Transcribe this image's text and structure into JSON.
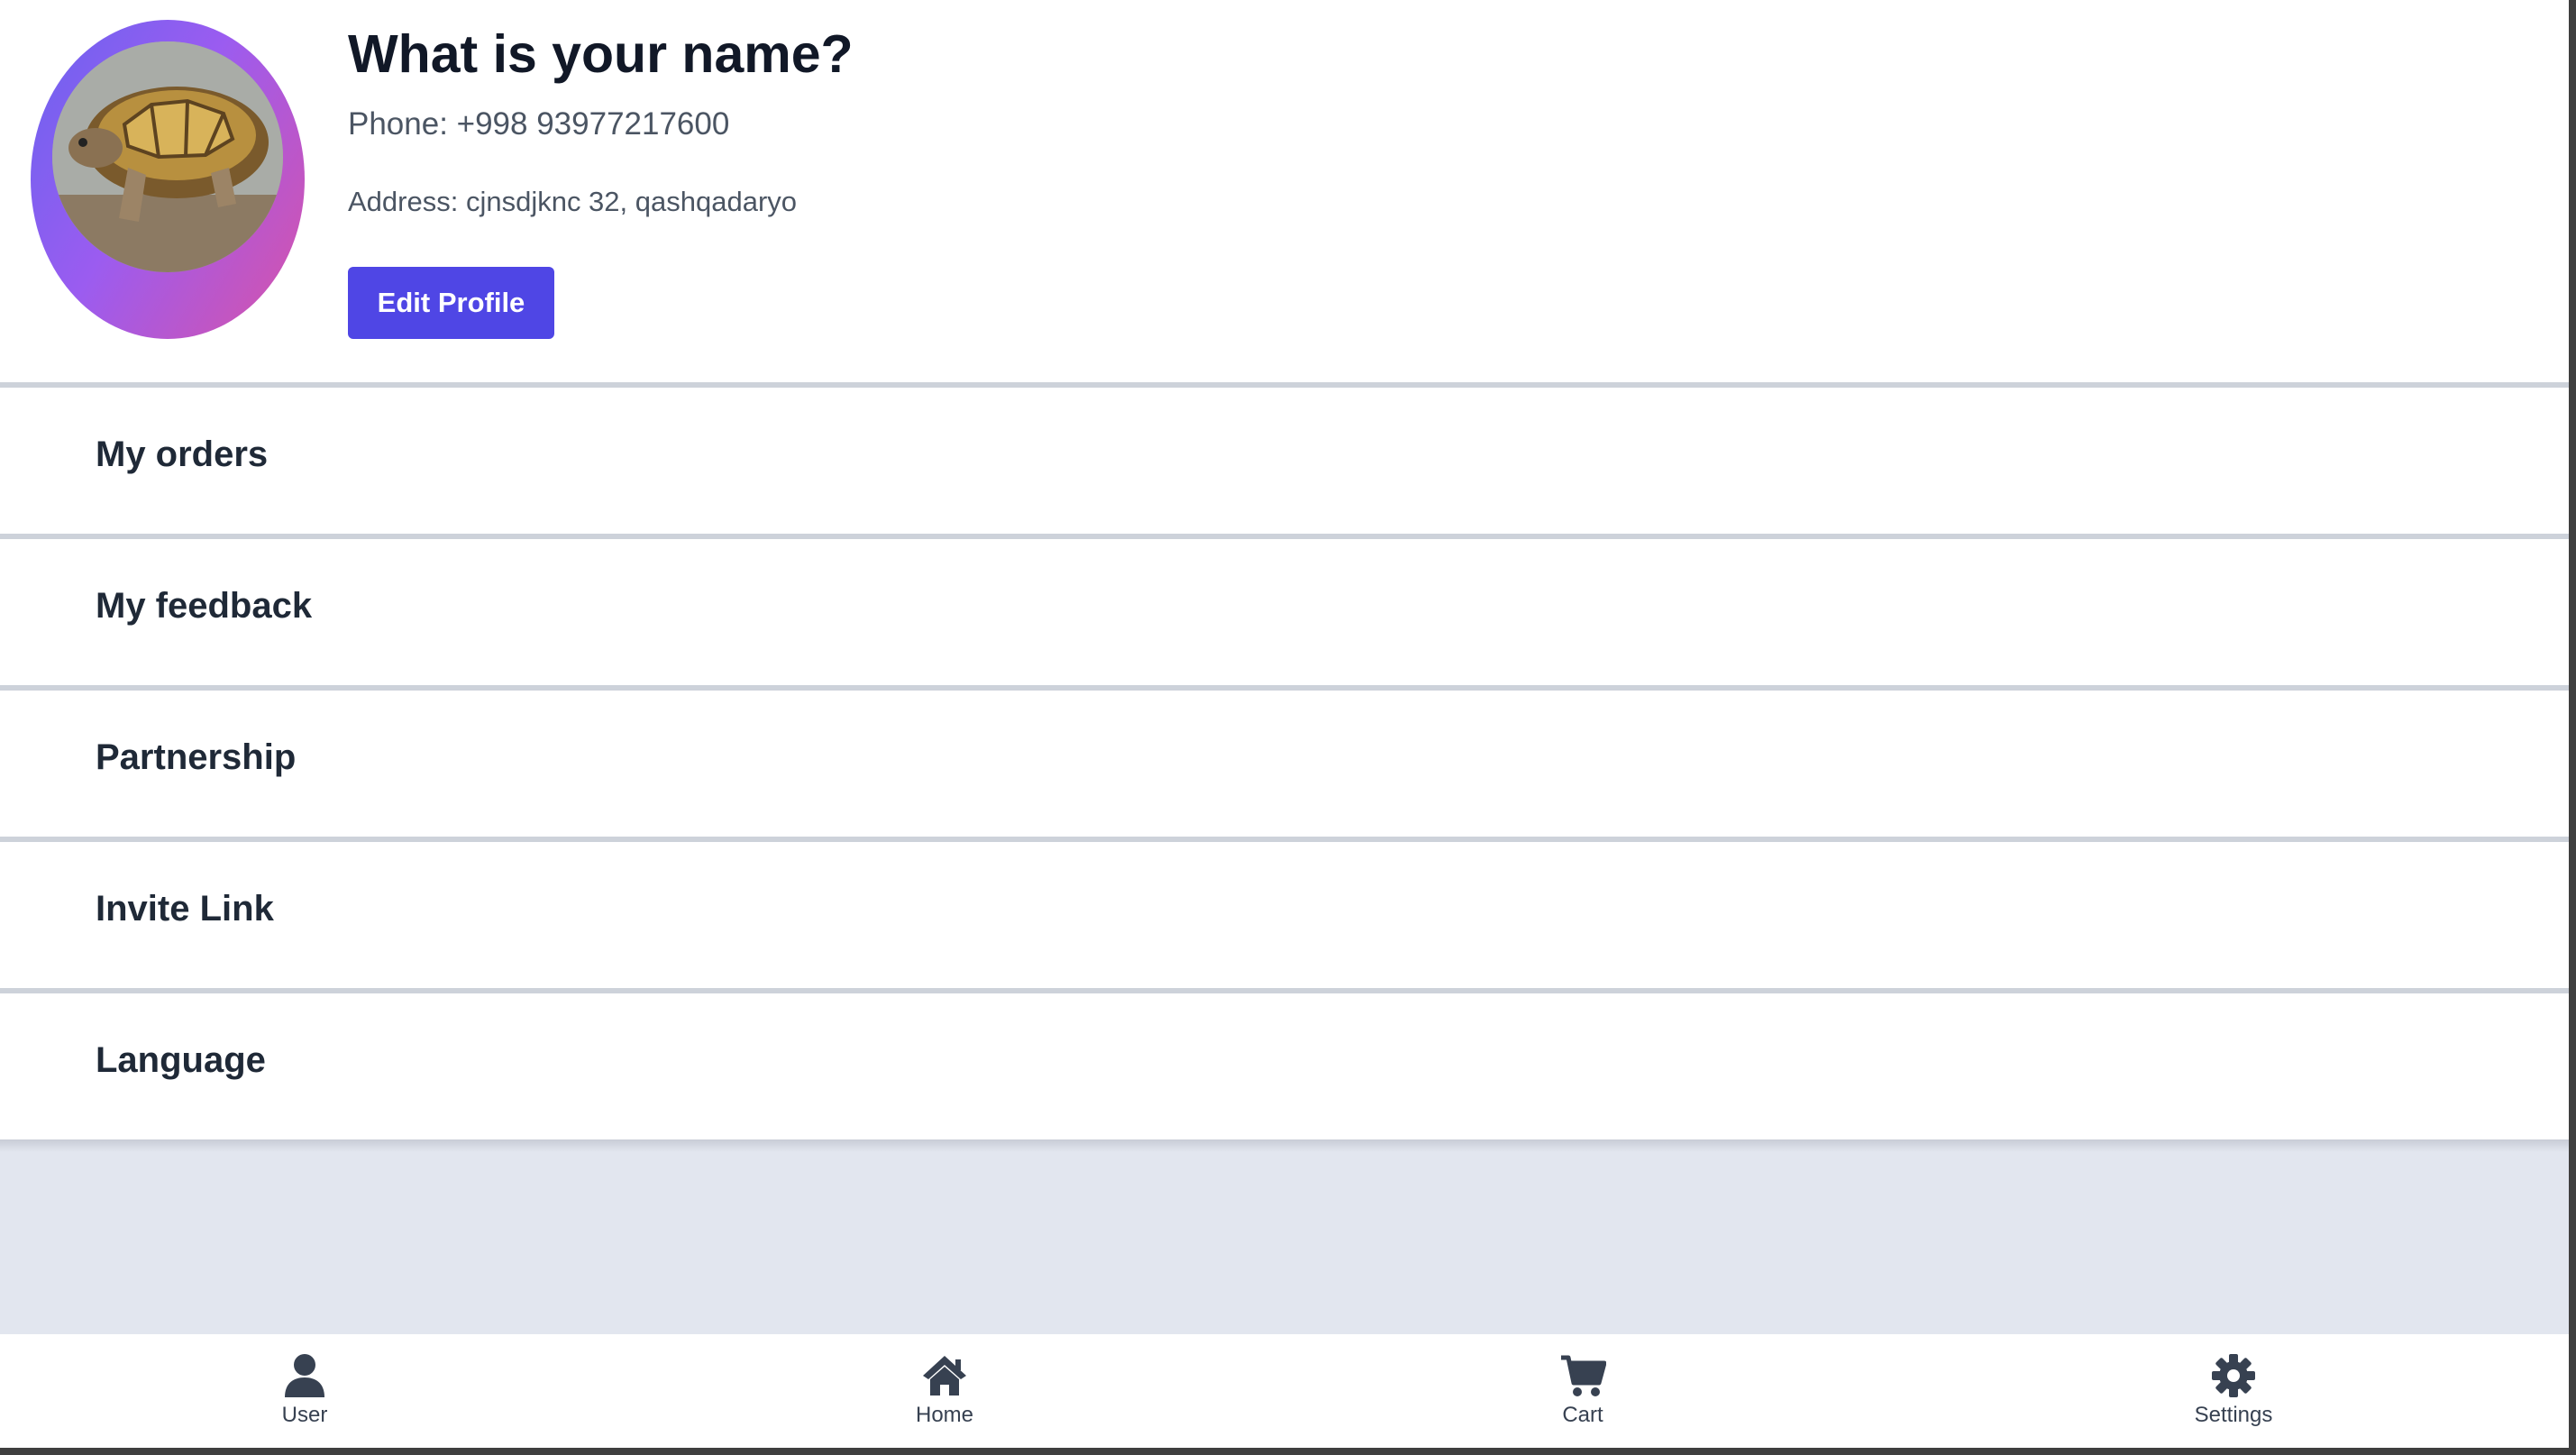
{
  "profile": {
    "name": "What is your name?",
    "phone": "Phone: +998 93977217600",
    "address": "Address: cjnsdjknc 32, qashqadaryo",
    "edit_label": "Edit Profile",
    "avatar_icon": "tortoise-photo"
  },
  "menu": {
    "items": [
      {
        "label": "My orders"
      },
      {
        "label": "My feedback"
      },
      {
        "label": "Partnership"
      },
      {
        "label": "Invite Link"
      },
      {
        "label": "Language"
      }
    ]
  },
  "bottom_nav": {
    "items": [
      {
        "label": "User",
        "icon": "user-icon"
      },
      {
        "label": "Home",
        "icon": "home-icon"
      },
      {
        "label": "Cart",
        "icon": "cart-icon"
      },
      {
        "label": "Settings",
        "icon": "gear-icon"
      }
    ]
  },
  "colors": {
    "accent": "#4f46e5",
    "avatar_gradient": [
      "#6a63f0",
      "#9b5cf0",
      "#d852a8"
    ],
    "page_background": "#e2e6ef",
    "nav_icon": "#374151"
  }
}
